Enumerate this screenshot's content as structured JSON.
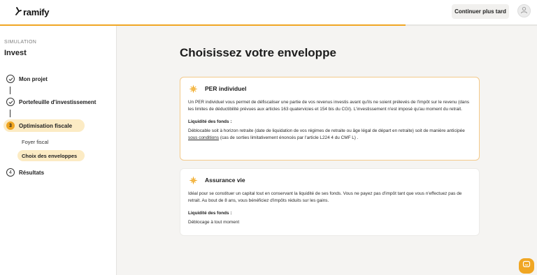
{
  "header": {
    "logo_text": "ramify",
    "continue_button": "Continuer plus tard",
    "progress_fraction": 0.755
  },
  "sidebar": {
    "section_label": "SIMULATION",
    "title": "Invest",
    "steps": [
      {
        "label": "Mon projet",
        "state": "done"
      },
      {
        "label": "Portefeuille d'investissement",
        "state": "done"
      },
      {
        "label": "Optimisation fiscale",
        "state": "active",
        "number": "3"
      },
      {
        "label": "Résultats",
        "state": "todo",
        "number": "4"
      }
    ],
    "substeps": [
      {
        "label": "Foyer fiscal"
      },
      {
        "label": "Choix des enveloppes",
        "active": true
      }
    ]
  },
  "main": {
    "title": "Choisissez votre enveloppe",
    "cards": [
      {
        "title": "PER individuel",
        "description": "Un PER individuel vous permet de défiscaliser une partie de vos revenus investis avant qu'ils ne soient prélevés de l'impôt sur le revenu (dans les limites de déductibilité prévues aux articles 163 quatervicies et 154 bis du CGI). L'investissement n'est imposé qu'au moment du retrait.",
        "liquidity_label": "Liquidité des fonds :",
        "liquidity_before": "Déblocable soit à horizon retraite (date de liquidation de vos régimes de retraite ou âge légal de départ en retraite) soit de manière anticipée ",
        "liquidity_link": "sous conditions",
        "liquidity_after": " (cas de sorties limitativement énoncés par l'article L224 4 du CMF L) ."
      },
      {
        "title": "Assurance vie",
        "description": "Idéal pour se constituer un capital tout en conservant la liquidité de ses fonds. Vous ne payez pas d'impôt tant que vous n'effectuez pas de retrait. Au bout de 8 ans, vous bénéficiez d'impôts réduits sur les gains.",
        "liquidity_label": "Liquidité des fonds :",
        "liquidity_text": "Déblocage à tout moment"
      }
    ]
  },
  "colors": {
    "accent": "#f0a623",
    "accent_soft": "#fcebc4",
    "selected_border": "#f3c98a"
  },
  "icons": [
    "ramify-logo-icon",
    "user-icon",
    "check-icon",
    "sparkle-icon",
    "chat-icon"
  ]
}
